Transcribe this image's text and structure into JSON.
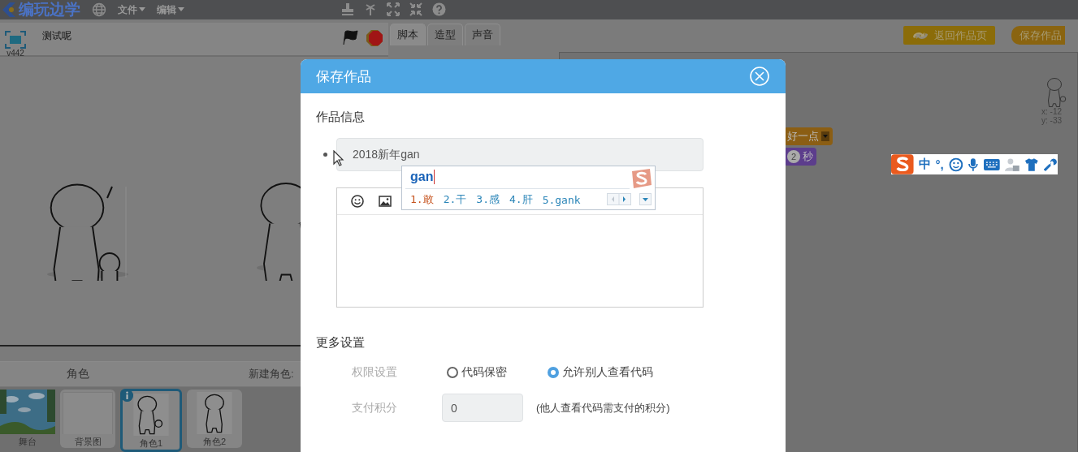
{
  "menubar": {
    "logo": "编玩边学",
    "menus": [
      {
        "label": "文件"
      },
      {
        "label": "编辑"
      }
    ]
  },
  "stage": {
    "version": "v442",
    "title": "测试呢"
  },
  "tabs": [
    {
      "label": "脚本",
      "selected": true
    },
    {
      "label": "造型",
      "selected": false
    },
    {
      "label": "声音",
      "selected": false
    }
  ],
  "header_buttons": [
    {
      "label": "返回作品页",
      "kind": "return"
    },
    {
      "label": "保存作品",
      "kind": "save"
    }
  ],
  "blocks": [
    {
      "kind": "dropdown",
      "text": "好一点",
      "color": "#8b5e14"
    },
    {
      "kind": "wait",
      "number": "2",
      "text": "秒",
      "color": "#5c3d8c"
    }
  ],
  "sprite_info": {
    "x": "x: -12",
    "y": "y: -33"
  },
  "ime_toolbar": {
    "items": [
      "中",
      "°,"
    ]
  },
  "sprites_panel": {
    "stage_label": "舞台",
    "title": "角色",
    "new_sprite": "新建角色:",
    "sprites": [
      {
        "name": "背景图",
        "selected": false
      },
      {
        "name": "角色1",
        "selected": true
      },
      {
        "name": "角色2",
        "selected": false
      }
    ]
  },
  "dialog": {
    "title": "保存作品",
    "section_1": "作品信息",
    "title_field": {
      "value": "2018新年gan"
    },
    "ime_popup": {
      "composition": "gan",
      "candidates": [
        {
          "label": "1.敢",
          "selected": true
        },
        {
          "label": "2.干",
          "selected": false
        },
        {
          "label": "3.感",
          "selected": false
        },
        {
          "label": "4.肝",
          "selected": false
        },
        {
          "label": "5.gank",
          "selected": false
        }
      ]
    },
    "section_2": "更多设置",
    "permission": {
      "label": "权限设置",
      "options": [
        {
          "label": "代码保密",
          "selected": false
        },
        {
          "label": "允许别人查看代码",
          "selected": true
        }
      ]
    },
    "points": {
      "label": "支付积分",
      "value": "0",
      "hint": "(他人查看代码需支付的积分)"
    }
  }
}
